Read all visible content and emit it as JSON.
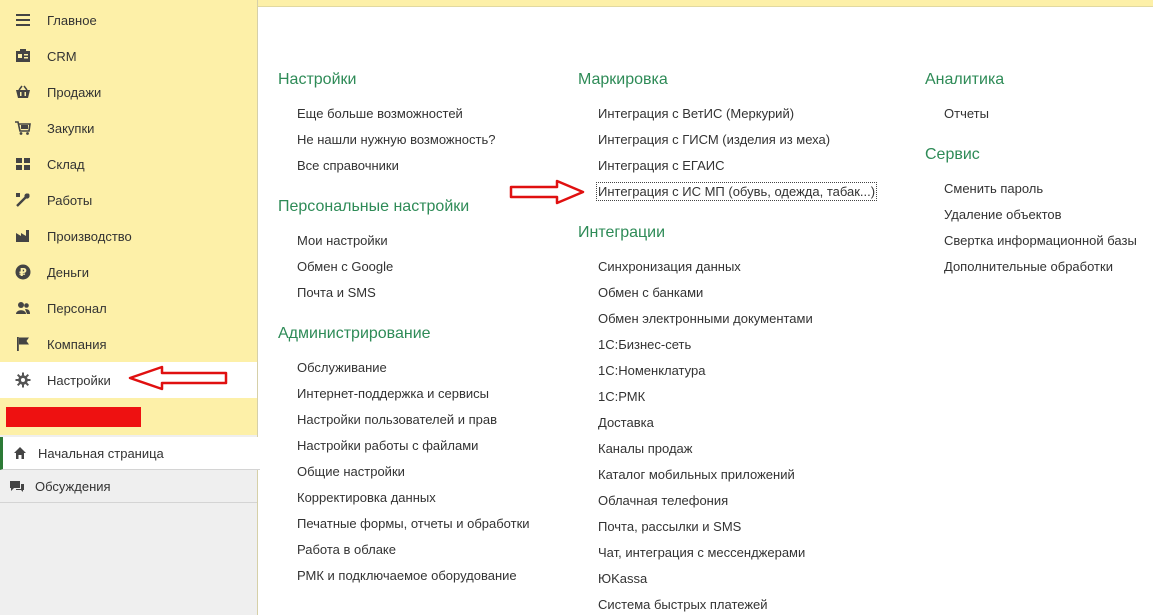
{
  "sidebar": {
    "items": [
      {
        "label": "Главное",
        "icon": "menu-lines-icon"
      },
      {
        "label": "CRM",
        "icon": "crm-card-icon"
      },
      {
        "label": "Продажи",
        "icon": "basket-icon"
      },
      {
        "label": "Закупки",
        "icon": "cart-icon"
      },
      {
        "label": "Склад",
        "icon": "warehouse-grid-icon"
      },
      {
        "label": "Работы",
        "icon": "tools-icon"
      },
      {
        "label": "Производство",
        "icon": "factory-icon"
      },
      {
        "label": "Деньги",
        "icon": "ruble-icon"
      },
      {
        "label": "Персонал",
        "icon": "people-icon"
      },
      {
        "label": "Компания",
        "icon": "flag-icon"
      },
      {
        "label": "Настройки",
        "icon": "gear-icon"
      }
    ]
  },
  "bottom_nav": {
    "items": [
      {
        "label": "Начальная страница",
        "icon": "home-icon"
      },
      {
        "label": "Обсуждения",
        "icon": "chat-icon"
      }
    ]
  },
  "sections": {
    "settings": {
      "title": "Настройки",
      "links": [
        "Еще больше возможностей",
        "Не нашли нужную возможность?",
        "Все справочники"
      ]
    },
    "personal": {
      "title": "Персональные настройки",
      "links": [
        "Мои настройки",
        "Обмен с Google",
        "Почта и SMS"
      ]
    },
    "admin": {
      "title": "Администрирование",
      "links": [
        "Обслуживание",
        "Интернет-поддержка и сервисы",
        "Настройки пользователей и прав",
        "Настройки работы с файлами",
        "Общие настройки",
        "Корректировка данных",
        "Печатные формы, отчеты и обработки",
        "Работа в облаке",
        "РМК и подключаемое оборудование"
      ]
    },
    "marking": {
      "title": "Маркировка",
      "links": [
        "Интеграция с ВетИС (Меркурий)",
        "Интеграция с ГИСМ (изделия из меха)",
        "Интеграция с ЕГАИС",
        "Интеграция с ИС МП (обувь, одежда, табак...)"
      ]
    },
    "integrations": {
      "title": "Интеграции",
      "links": [
        "Синхронизация данных",
        "Обмен с банками",
        "Обмен электронными документами",
        "1С:Бизнес-сеть",
        "1С:Номенклатура",
        "1С:РМК",
        "Доставка",
        "Каналы продаж",
        "Каталог мобильных приложений",
        "Облачная телефония",
        "Почта, рассылки и SMS",
        "Чат, интеграция с мессенджерами",
        "ЮKassa",
        "Система быстрых платежей"
      ]
    },
    "analytics": {
      "title": "Аналитика",
      "links": [
        "Отчеты"
      ]
    },
    "service": {
      "title": "Сервис",
      "links": [
        "Сменить пароль",
        "Удаление объектов",
        "Свертка информационной базы",
        "Дополнительные обработки"
      ]
    }
  },
  "colors": {
    "sidebar_bg": "#fdf0a8",
    "section_title": "#2e8b57",
    "annotation_red": "#ee1111"
  }
}
